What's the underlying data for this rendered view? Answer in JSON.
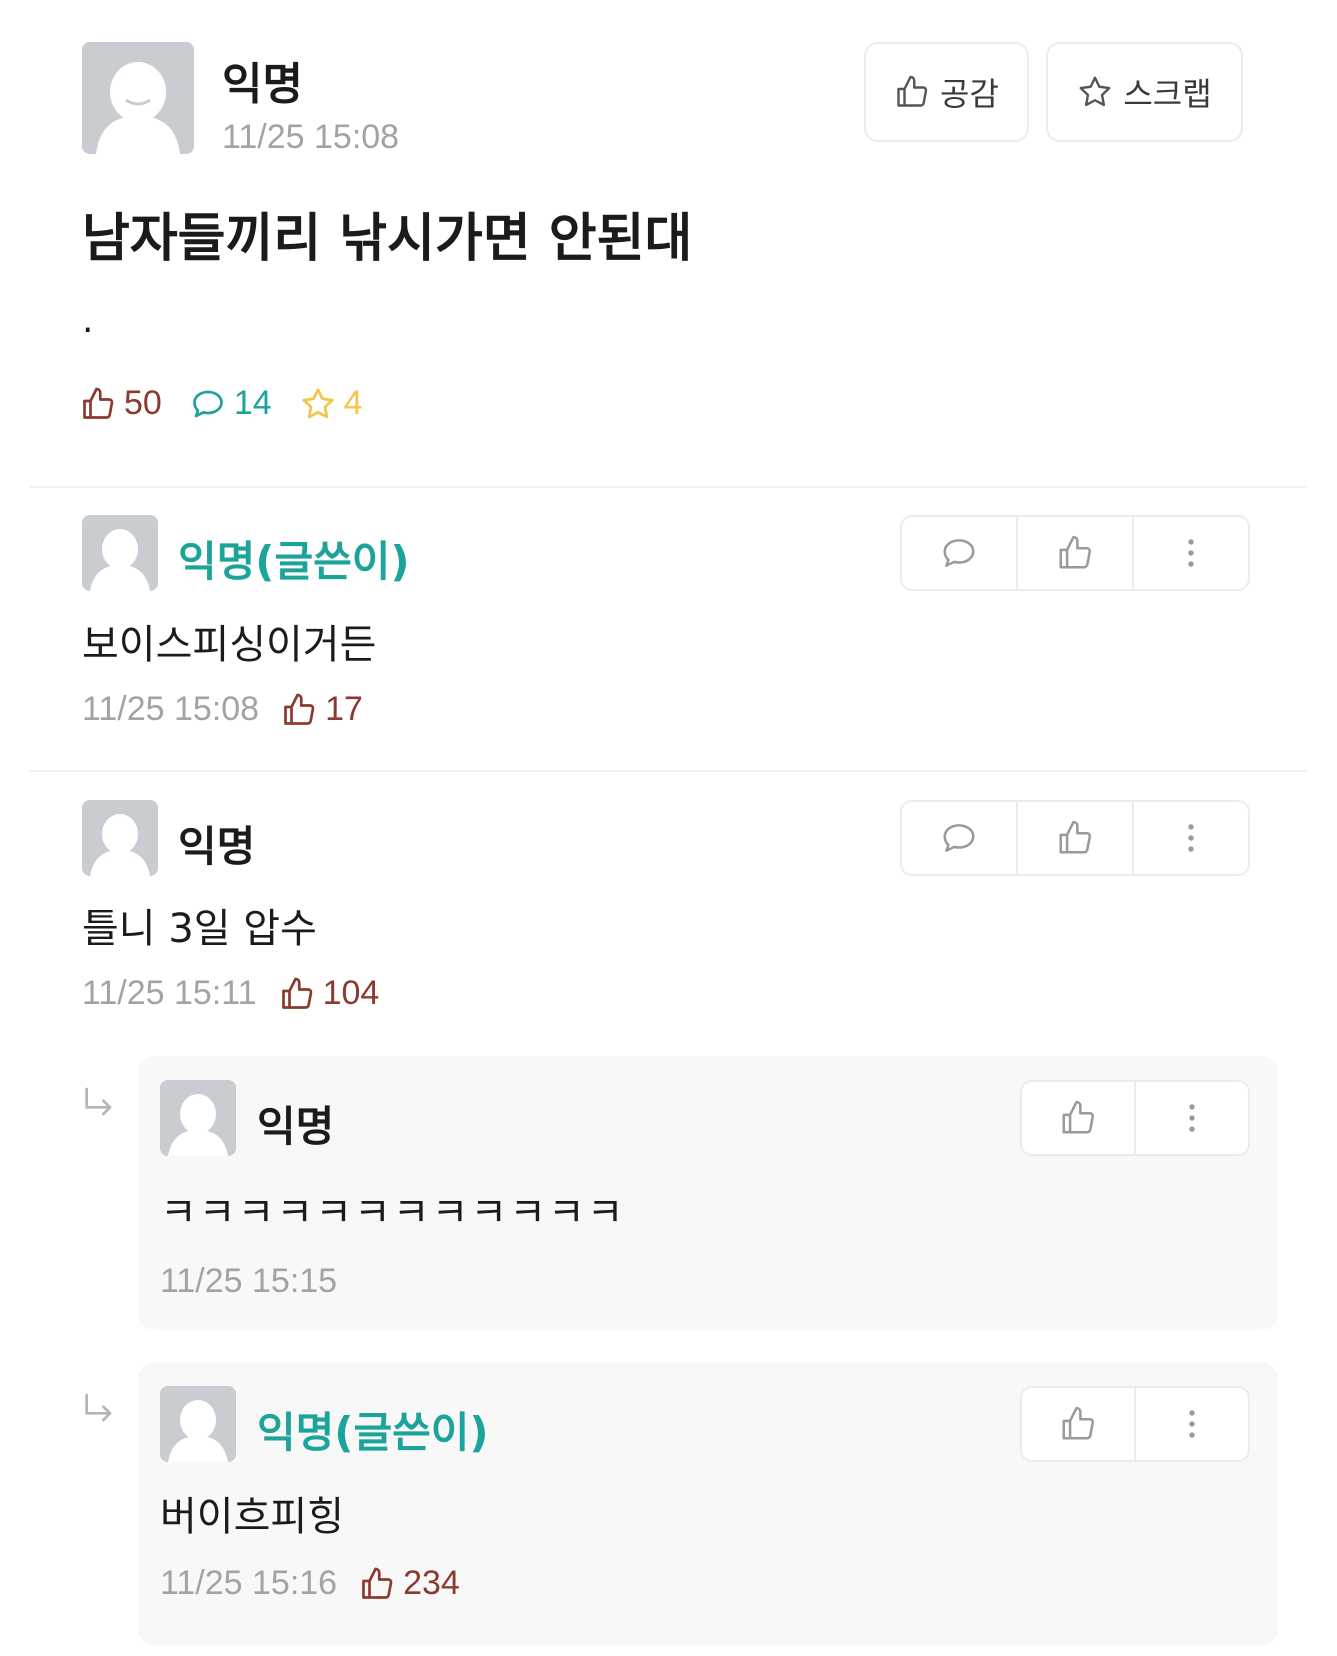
{
  "post": {
    "author": "익명",
    "time": "11/25 15:08",
    "title": "남자들끼리 낚시가면 안된대",
    "body": ".",
    "like_button_label": "공감",
    "scrap_button_label": "스크랩",
    "stats": {
      "likes": "50",
      "comments": "14",
      "scraps": "4"
    }
  },
  "comments": [
    {
      "author": "익명(글쓴이)",
      "text": "보이스피싱이거든",
      "time": "11/25 15:08",
      "likes": "17"
    },
    {
      "author": "익명",
      "text": "틀니 3일 압수",
      "time": "11/25 15:11",
      "likes": "104"
    }
  ],
  "replies": [
    {
      "author": "익명",
      "text": "ㅋㅋㅋㅋㅋㅋㅋㅋㅋㅋㅋㅋ",
      "time": "11/25 15:15"
    },
    {
      "author": "익명(글쓴이)",
      "text": "버이흐피힝",
      "time": "11/25 15:16",
      "likes": "234"
    }
  ],
  "colors": {
    "author_op": "#1ca39a",
    "like": "#8b3a2f",
    "comment": "#1ca39a",
    "scrap": "#f3c54a",
    "time": "#a3a3a3"
  }
}
